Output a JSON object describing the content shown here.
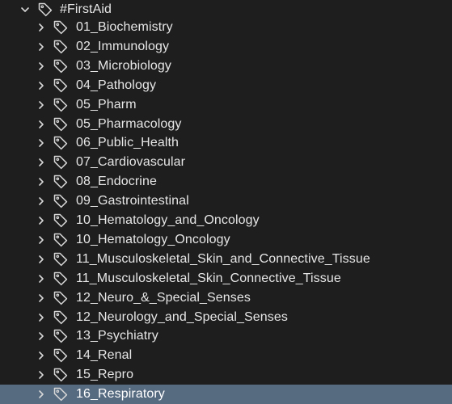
{
  "colors": {
    "background": "#1e1e1e",
    "text": "#e6e6e6",
    "icon": "#d7d7d7",
    "selected_background": "#566a80"
  },
  "tree": {
    "root": {
      "label": "#FirstAid",
      "expanded": true,
      "chevron_icon": "chevron-down-icon",
      "tag_icon": "tag-icon"
    },
    "items": [
      {
        "label": "01_Biochemistry",
        "selected": false
      },
      {
        "label": "02_Immunology",
        "selected": false
      },
      {
        "label": "03_Microbiology",
        "selected": false
      },
      {
        "label": "04_Pathology",
        "selected": false
      },
      {
        "label": "05_Pharm",
        "selected": false
      },
      {
        "label": "05_Pharmacology",
        "selected": false
      },
      {
        "label": "06_Public_Health",
        "selected": false
      },
      {
        "label": "07_Cardiovascular",
        "selected": false
      },
      {
        "label": "08_Endocrine",
        "selected": false
      },
      {
        "label": "09_Gastrointestinal",
        "selected": false
      },
      {
        "label": "10_Hematology_and_Oncology",
        "selected": false
      },
      {
        "label": "10_Hematology_Oncology",
        "selected": false
      },
      {
        "label": "11_Musculoskeletal_Skin_and_Connective_Tissue",
        "selected": false
      },
      {
        "label": "11_Musculoskeletal_Skin_Connective_Tissue",
        "selected": false
      },
      {
        "label": "12_Neuro_&_Special_Senses",
        "selected": false
      },
      {
        "label": "12_Neurology_and_Special_Senses",
        "selected": false
      },
      {
        "label": "13_Psychiatry",
        "selected": false
      },
      {
        "label": "14_Renal",
        "selected": false
      },
      {
        "label": "15_Repro",
        "selected": false
      },
      {
        "label": "16_Respiratory",
        "selected": true
      }
    ]
  }
}
